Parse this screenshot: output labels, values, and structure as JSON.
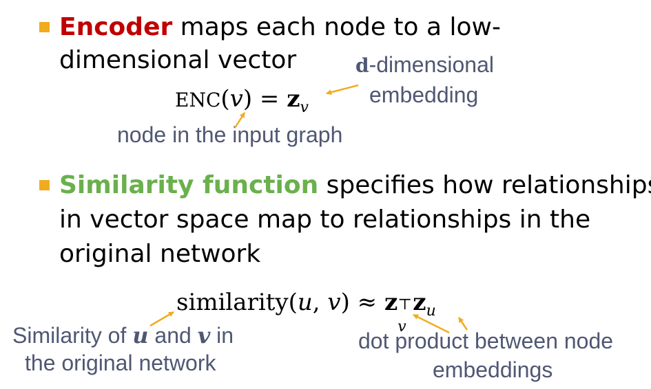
{
  "bullet1": {
    "keyword": "Encoder",
    "rest_line1": " maps each node to a low-",
    "line2": "dimensional vector"
  },
  "eq1": {
    "enc": "ENC",
    "open": "(",
    "v": "v",
    "close": ") =",
    "z": "z",
    "sub": "v"
  },
  "anno_embedding": {
    "bold_d": "d",
    "line1_rest": "-dimensional",
    "line2": "embedding"
  },
  "anno_node": "node in the input graph",
  "bullet2": {
    "keyword": "Similarity function",
    "rest_line1": " specifies how relationships",
    "line2": "in vector space map to relationships in the",
    "line3": "original network"
  },
  "eq2": {
    "func": "similarity(",
    "u": "u",
    "comma": ", ",
    "v": "v",
    "close": ") ≈",
    "z1": "z",
    "sup": "⊤",
    "sub1": "v",
    "z2": "z",
    "sub2": "u"
  },
  "anno_similarity": {
    "pre": "Similarity of ",
    "u": "u",
    "mid": " and ",
    "v": "v",
    "post": " in",
    "line2": "the original network"
  },
  "anno_dot": {
    "line1": "dot product between node",
    "line2": "embeddings"
  },
  "colors": {
    "bullet": "#f0ab1e",
    "encoder": "#c00000",
    "similarity": "#6ab04c",
    "annotation": "#4f5773",
    "arrow": "#f0ab1e"
  }
}
